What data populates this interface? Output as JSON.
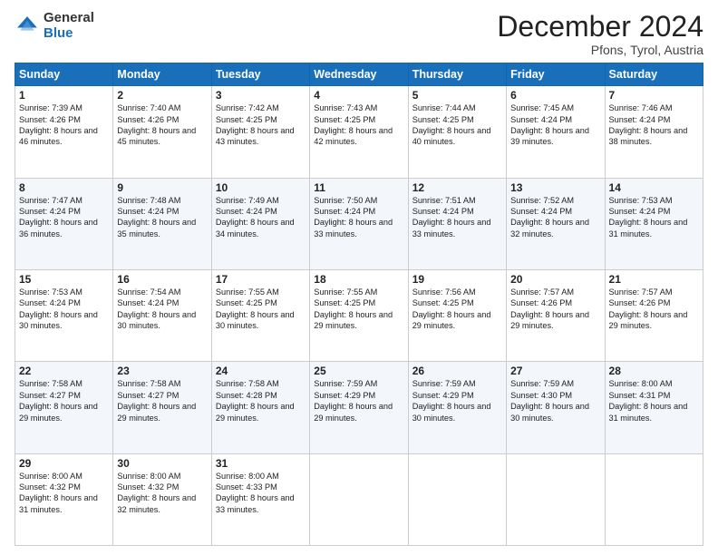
{
  "header": {
    "logo_general": "General",
    "logo_blue": "Blue",
    "month_title": "December 2024",
    "location": "Pfons, Tyrol, Austria"
  },
  "days_of_week": [
    "Sunday",
    "Monday",
    "Tuesday",
    "Wednesday",
    "Thursday",
    "Friday",
    "Saturday"
  ],
  "weeks": [
    [
      {
        "day": 1,
        "sunrise": "7:39 AM",
        "sunset": "4:26 PM",
        "daylight": "8 hours and 46 minutes."
      },
      {
        "day": 2,
        "sunrise": "7:40 AM",
        "sunset": "4:26 PM",
        "daylight": "8 hours and 45 minutes."
      },
      {
        "day": 3,
        "sunrise": "7:42 AM",
        "sunset": "4:25 PM",
        "daylight": "8 hours and 43 minutes."
      },
      {
        "day": 4,
        "sunrise": "7:43 AM",
        "sunset": "4:25 PM",
        "daylight": "8 hours and 42 minutes."
      },
      {
        "day": 5,
        "sunrise": "7:44 AM",
        "sunset": "4:25 PM",
        "daylight": "8 hours and 40 minutes."
      },
      {
        "day": 6,
        "sunrise": "7:45 AM",
        "sunset": "4:24 PM",
        "daylight": "8 hours and 39 minutes."
      },
      {
        "day": 7,
        "sunrise": "7:46 AM",
        "sunset": "4:24 PM",
        "daylight": "8 hours and 38 minutes."
      }
    ],
    [
      {
        "day": 8,
        "sunrise": "7:47 AM",
        "sunset": "4:24 PM",
        "daylight": "8 hours and 36 minutes."
      },
      {
        "day": 9,
        "sunrise": "7:48 AM",
        "sunset": "4:24 PM",
        "daylight": "8 hours and 35 minutes."
      },
      {
        "day": 10,
        "sunrise": "7:49 AM",
        "sunset": "4:24 PM",
        "daylight": "8 hours and 34 minutes."
      },
      {
        "day": 11,
        "sunrise": "7:50 AM",
        "sunset": "4:24 PM",
        "daylight": "8 hours and 33 minutes."
      },
      {
        "day": 12,
        "sunrise": "7:51 AM",
        "sunset": "4:24 PM",
        "daylight": "8 hours and 33 minutes."
      },
      {
        "day": 13,
        "sunrise": "7:52 AM",
        "sunset": "4:24 PM",
        "daylight": "8 hours and 32 minutes."
      },
      {
        "day": 14,
        "sunrise": "7:53 AM",
        "sunset": "4:24 PM",
        "daylight": "8 hours and 31 minutes."
      }
    ],
    [
      {
        "day": 15,
        "sunrise": "7:53 AM",
        "sunset": "4:24 PM",
        "daylight": "8 hours and 30 minutes."
      },
      {
        "day": 16,
        "sunrise": "7:54 AM",
        "sunset": "4:24 PM",
        "daylight": "8 hours and 30 minutes."
      },
      {
        "day": 17,
        "sunrise": "7:55 AM",
        "sunset": "4:25 PM",
        "daylight": "8 hours and 30 minutes."
      },
      {
        "day": 18,
        "sunrise": "7:55 AM",
        "sunset": "4:25 PM",
        "daylight": "8 hours and 29 minutes."
      },
      {
        "day": 19,
        "sunrise": "7:56 AM",
        "sunset": "4:25 PM",
        "daylight": "8 hours and 29 minutes."
      },
      {
        "day": 20,
        "sunrise": "7:57 AM",
        "sunset": "4:26 PM",
        "daylight": "8 hours and 29 minutes."
      },
      {
        "day": 21,
        "sunrise": "7:57 AM",
        "sunset": "4:26 PM",
        "daylight": "8 hours and 29 minutes."
      }
    ],
    [
      {
        "day": 22,
        "sunrise": "7:58 AM",
        "sunset": "4:27 PM",
        "daylight": "8 hours and 29 minutes."
      },
      {
        "day": 23,
        "sunrise": "7:58 AM",
        "sunset": "4:27 PM",
        "daylight": "8 hours and 29 minutes."
      },
      {
        "day": 24,
        "sunrise": "7:58 AM",
        "sunset": "4:28 PM",
        "daylight": "8 hours and 29 minutes."
      },
      {
        "day": 25,
        "sunrise": "7:59 AM",
        "sunset": "4:29 PM",
        "daylight": "8 hours and 29 minutes."
      },
      {
        "day": 26,
        "sunrise": "7:59 AM",
        "sunset": "4:29 PM",
        "daylight": "8 hours and 30 minutes."
      },
      {
        "day": 27,
        "sunrise": "7:59 AM",
        "sunset": "4:30 PM",
        "daylight": "8 hours and 30 minutes."
      },
      {
        "day": 28,
        "sunrise": "8:00 AM",
        "sunset": "4:31 PM",
        "daylight": "8 hours and 31 minutes."
      }
    ],
    [
      {
        "day": 29,
        "sunrise": "8:00 AM",
        "sunset": "4:32 PM",
        "daylight": "8 hours and 31 minutes."
      },
      {
        "day": 30,
        "sunrise": "8:00 AM",
        "sunset": "4:32 PM",
        "daylight": "8 hours and 32 minutes."
      },
      {
        "day": 31,
        "sunrise": "8:00 AM",
        "sunset": "4:33 PM",
        "daylight": "8 hours and 33 minutes."
      },
      null,
      null,
      null,
      null
    ]
  ]
}
